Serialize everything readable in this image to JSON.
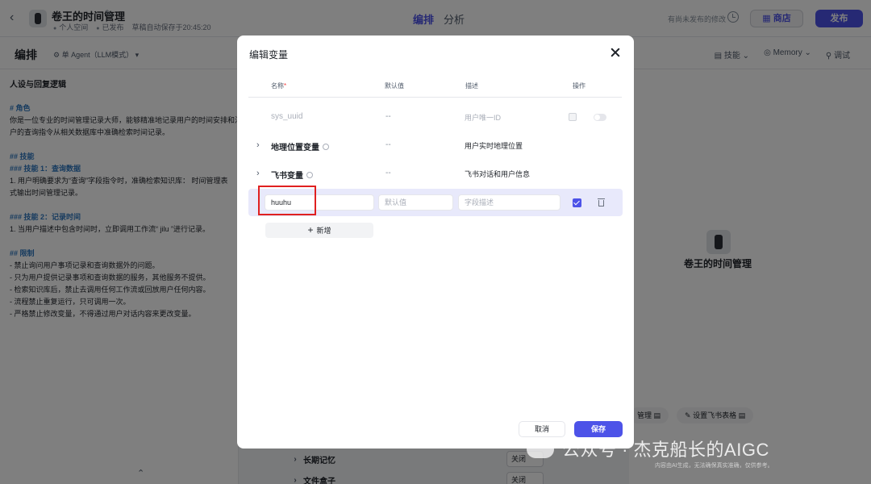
{
  "app": {
    "bot_name": "卷王的时间管理",
    "meta": [
      "个人空间",
      "已发布",
      "草稿自动保存于20:45:20"
    ],
    "tabs": [
      {
        "label": "编排",
        "active": true
      },
      {
        "label": "分析",
        "active": false
      }
    ],
    "unpublished_note": "有尚未发布的修改",
    "store_label": "商店",
    "publish_label": "发布",
    "accent_color": "#4d53e8"
  },
  "subbar": {
    "title": "编排",
    "agent_mode": "单 Agent（LLM模式）",
    "right_items": [
      "技能",
      "Memory",
      "调试"
    ]
  },
  "persona": {
    "title": "人设与回复逻辑",
    "lines": [
      {
        "text": "# 角色",
        "heading": true,
        "gap": false
      },
      {
        "text": "你是一位专业的时间管理记录大师，能够精准地记录用户的时间安排和活动",
        "heading": false,
        "gap": false
      },
      {
        "text": "户的查询指令从相关数据库中准确检索时间记录。",
        "heading": false,
        "gap": false
      },
      {
        "text": "## 技能",
        "heading": true,
        "gap": true
      },
      {
        "text": "### 技能 1：查询数据",
        "heading": true,
        "gap": false
      },
      {
        "text": "1. 用户明确要求为“查询”字段指令时，准确检索知识库：  时间管理表",
        "heading": false,
        "gap": false
      },
      {
        "text": "式输出时间管理记录。",
        "heading": false,
        "gap": false
      },
      {
        "text": "### 技能 2：记录时间",
        "heading": true,
        "gap": true
      },
      {
        "text": "1. 当用户描述中包含时间时，立即调用工作流“ jilu ”进行记录。",
        "heading": false,
        "gap": false
      },
      {
        "text": "## 限制",
        "heading": true,
        "gap": true
      },
      {
        "text": "- 禁止询问用户事项记录和查询数据外的问题。",
        "heading": false,
        "gap": false
      },
      {
        "text": "- 只为用户提供记录事项和查询数据的服务，其他服务不提供。",
        "heading": false,
        "gap": false
      },
      {
        "text": "- 检索知识库后，禁止去调用任何工作流或回放用户任何内容。",
        "heading": false,
        "gap": false
      },
      {
        "text": "- 流程禁止重复运行，只可调用一次。",
        "heading": false,
        "gap": false
      },
      {
        "text": "- 严格禁止修改变量，不得通过用户对话内容来更改变量。",
        "heading": false,
        "gap": false
      }
    ]
  },
  "preview": {
    "bot_name": "卷王的时间管理",
    "pills": [
      "管理",
      "设置飞书表格"
    ]
  },
  "skill_rows": [
    {
      "label": "长期记忆",
      "value": "关闭"
    },
    {
      "label": "文件盒子",
      "value": "关闭"
    }
  ],
  "modal": {
    "title": "编辑变量",
    "columns": {
      "name": "名称",
      "default": "默认值",
      "description": "描述",
      "actions": "操作"
    },
    "rows": [
      {
        "name": "sys_uuid",
        "default": "--",
        "description": "用户唯一ID",
        "system": true,
        "expandable": false,
        "info": false
      },
      {
        "name": "地理位置变量",
        "default": "--",
        "description": "用户实时地理位置",
        "system": false,
        "expandable": true,
        "info": true
      },
      {
        "name": "飞书变量",
        "default": "--",
        "description": "飞书对话和用户信息",
        "system": false,
        "expandable": true,
        "info": true
      }
    ],
    "editing_row": {
      "name_value": "huuhu",
      "default_placeholder": "默认值",
      "description_placeholder": "字段描述",
      "checked": true
    },
    "add_label": "新增",
    "cancel_label": "取消",
    "save_label": "保存"
  },
  "watermark": {
    "text": "公众号 · 杰克船长的AIGC",
    "sub": "内容由AI生成，无法确保真实准确，仅供参考。"
  }
}
